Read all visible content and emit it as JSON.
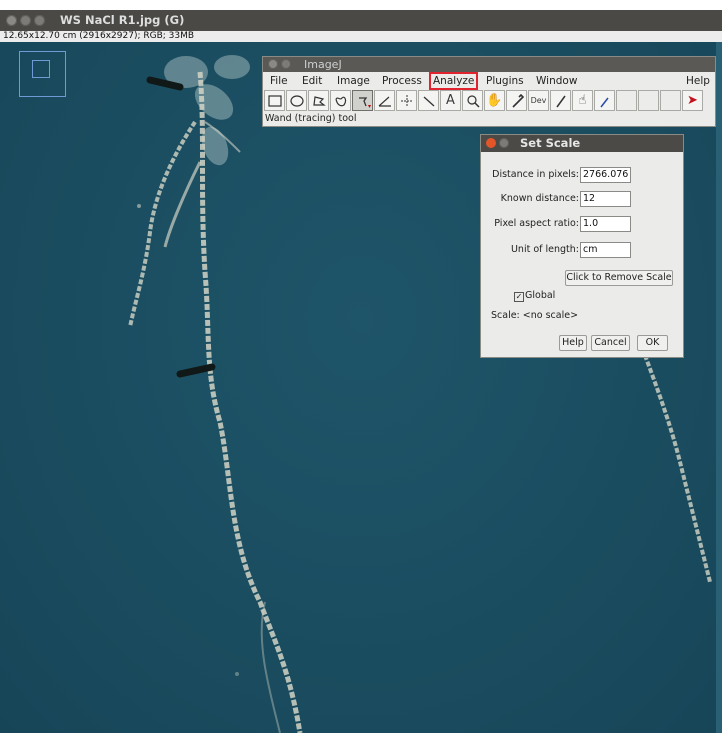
{
  "image_window": {
    "title": "WS NaCl R1.jpg (G)",
    "info": "12.65x12.70 cm (2916x2927); RGB; 33MB"
  },
  "imagej": {
    "title": "ImageJ",
    "menus": [
      "File",
      "Edit",
      "Image",
      "Process",
      "Analyze",
      "Plugins",
      "Window",
      "Help"
    ],
    "highlighted_menu": "Analyze",
    "status": "Wand (tracing) tool",
    "toolbar_icons": [
      "rectangle-icon",
      "oval-icon",
      "polygon-icon",
      "freehand-icon",
      "wand-icon",
      "angle-icon",
      "point-icon",
      "line-icon",
      "text-icon",
      "magnifier-icon",
      "hand-icon",
      "color-picker-icon",
      "dev-icon",
      "brush-icon",
      "hand-tool-icon",
      "dropper-icon",
      "more-tools-icon"
    ],
    "dev_label": "Dev"
  },
  "set_scale": {
    "title": "Set Scale",
    "distance_label": "Distance in pixels:",
    "distance_value": "2766.076",
    "known_label": "Known distance:",
    "known_value": "12",
    "aspect_label": "Pixel aspect ratio:",
    "aspect_value": "1.0",
    "unit_label": "Unit of length:",
    "unit_value": "cm",
    "remove_button": "Click to Remove Scale",
    "global_label": "Global",
    "global_checked": true,
    "scale_text": "Scale: <no scale>",
    "help_button": "Help",
    "cancel_button": "Cancel",
    "ok_button": "OK"
  },
  "colors": {
    "canvas_bg": "#1c4e61",
    "highlight": "#e0232e",
    "window_bg": "#ebebe9"
  }
}
